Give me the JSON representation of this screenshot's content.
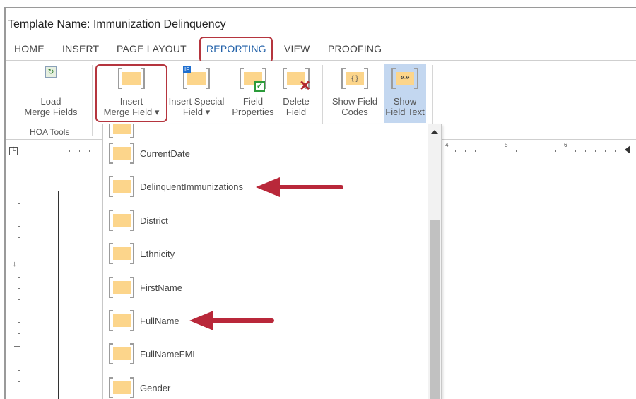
{
  "window": {
    "title": "Template Name: Immunization Delinquency"
  },
  "tabs": [
    {
      "label": "HOME"
    },
    {
      "label": "INSERT"
    },
    {
      "label": "PAGE LAYOUT"
    },
    {
      "label": "REPORTING"
    },
    {
      "label": "VIEW"
    },
    {
      "label": "PROOFING"
    }
  ],
  "active_tab": "REPORTING",
  "ribbon": {
    "hoa_tools": {
      "group_label": "HOA Tools",
      "load_merge_fields": {
        "line1": "Load",
        "line2": "Merge Fields"
      }
    },
    "insert_merge_field": {
      "line1": "Insert",
      "line2": "Merge Field ▾"
    },
    "insert_special_field": {
      "line1": "Insert Special",
      "line2": "Field ▾",
      "badge": "IF"
    },
    "field_properties": {
      "line1": "Field",
      "line2": "Properties"
    },
    "delete_field": {
      "line1": "Delete",
      "line2": "Field"
    },
    "show_field_codes": {
      "line1": "Show Field",
      "line2": "Codes",
      "glyph": "{ }"
    },
    "show_field_text": {
      "line1": "Show",
      "line2": "Field Text",
      "glyph": "«»"
    }
  },
  "ruler": {
    "marks": [
      "4",
      "5",
      "6"
    ]
  },
  "merge_fields": [
    {
      "label": "CurrentDate"
    },
    {
      "label": "DelinquentImmunizations"
    },
    {
      "label": "District"
    },
    {
      "label": "Ethnicity"
    },
    {
      "label": "FirstName"
    },
    {
      "label": "FullName"
    },
    {
      "label": "FullNameFML"
    },
    {
      "label": "Gender"
    }
  ],
  "colors": {
    "accent_tab": "#1f5fa8",
    "highlight": "#b5353e",
    "arrow": "#b9283a",
    "field_fill": "#fcd58b",
    "pressed": "#c3d7f0"
  }
}
